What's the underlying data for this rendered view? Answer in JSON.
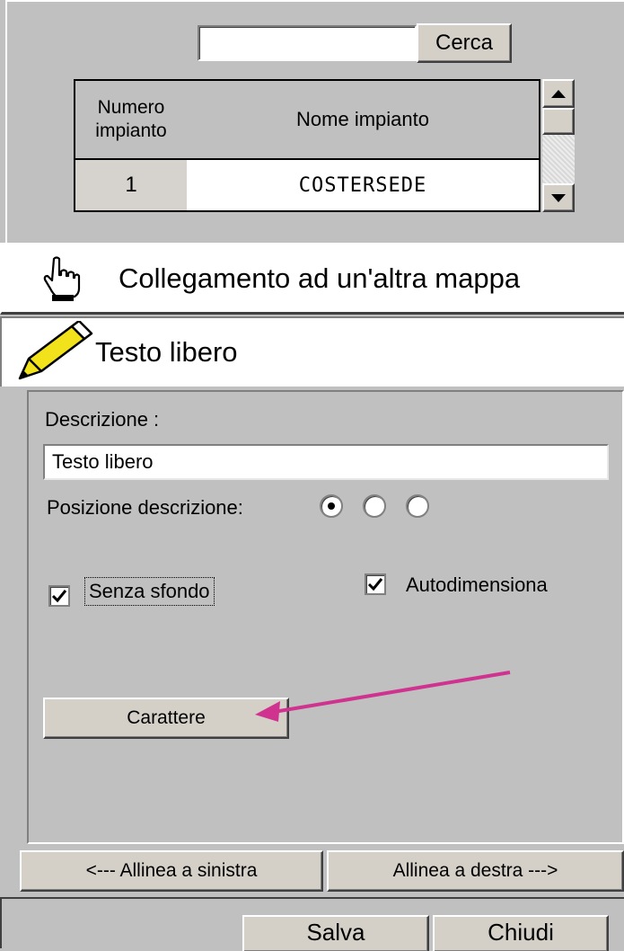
{
  "search": {
    "value": "",
    "button_label": "Cerca"
  },
  "grid": {
    "columns": [
      "Numero\nimpianto",
      "Nome impianto"
    ],
    "rows": [
      {
        "number": "1",
        "name": "COSTERSEDE"
      }
    ]
  },
  "tabs": {
    "link_label": "Collegamento ad un'altra mappa",
    "link_icon": "hand-pointer-icon",
    "text_label": "Testo libero",
    "text_icon": "pencil-icon"
  },
  "properties": {
    "description_label": "Descrizione :",
    "description_value": "Testo libero",
    "position_label": "Posizione descrizione:",
    "position_selected": 1,
    "no_background_label": "Senza sfondo",
    "no_background_checked": true,
    "autosize_label": "Autodimensiona",
    "autosize_checked": true,
    "font_button_label": "Carattere"
  },
  "align": {
    "left_label": "<---  Allinea a sinistra",
    "right_label": "Allinea a destra  --->"
  },
  "footer": {
    "save_label": "Salva",
    "close_label": "Chiudi"
  },
  "colors": {
    "face": "#c0c0c0",
    "annotation_arrow": "#d0338f",
    "pencil": "#f2e21c"
  }
}
